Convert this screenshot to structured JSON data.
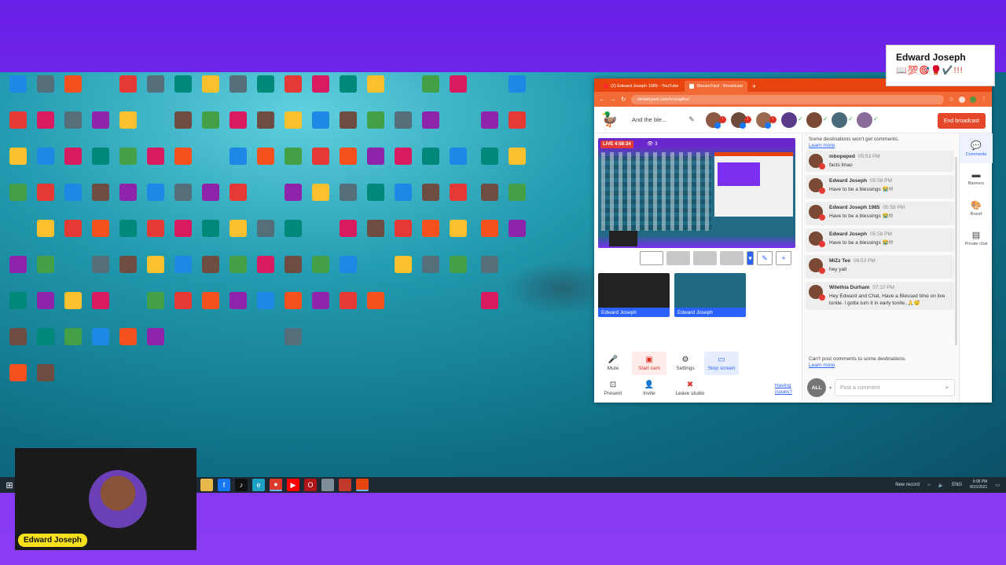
{
  "namecard": {
    "name": "Edward Joseph",
    "emoji": "📖💯🎯🥊✔️!!!"
  },
  "webcam": {
    "name": "Edward Joseph"
  },
  "browser": {
    "tabs": [
      {
        "label": "(2) Edward Joseph 1985 - YouTube"
      },
      {
        "label": "StreamYard - Broadcast"
      }
    ],
    "new_tab": "+",
    "url": "streamyard.com/rcxzugfhu/"
  },
  "studio": {
    "title": "And the ble...",
    "end_broadcast": "End broadcast",
    "live": "LIVE 4:58:34",
    "viewers": "👁 3",
    "sources": [
      {
        "name": "Edward Joseph"
      },
      {
        "name": "Edward Joseph"
      }
    ],
    "controls": {
      "mute": "Mute",
      "start_cam": "Start cam",
      "settings": "Settings",
      "stop_screen": "Stop screen",
      "present": "Present",
      "invite": "Invite",
      "leave": "Leave studio"
    },
    "help": "Having issues?"
  },
  "chat": {
    "notice_top": "Some destinations won't get comments.",
    "learn_more": "Learn more",
    "messages": [
      {
        "name": "mbopeped",
        "time": "05:53 PM",
        "text": "facts lmao"
      },
      {
        "name": "Edward Joseph",
        "time": "05:58 PM",
        "text": "Have to be a blessings 😭!!!"
      },
      {
        "name": "Edward Joseph 1985",
        "time": "05:58 PM",
        "text": "Have to be a blessings 😭!!!"
      },
      {
        "name": "Edward Joseph",
        "time": "05:58 PM",
        "text": "Have to be a blessings 😭!!!"
      },
      {
        "name": "MiZz Tee",
        "time": "06:53 PM",
        "text": "hey yall"
      },
      {
        "name": "Wilethia Durham",
        "time": "07:10 PM",
        "text": "Hey Edward and Chat, Have a Blessed time on live tonite. I gotta turn it in early tonite..🙏😴"
      }
    ],
    "notice_bottom": "Can't post comments to some destinations.",
    "all": "ALL",
    "composer_placeholder": "Post a comment"
  },
  "sidebar": {
    "items": [
      {
        "label": "Comments"
      },
      {
        "label": "Banners"
      },
      {
        "label": "Brand"
      },
      {
        "label": "Private chat"
      }
    ]
  },
  "taskbar": {
    "news": "New record",
    "time": "9:08 PM",
    "date": "8/15/2021",
    "lang": "ENG"
  }
}
